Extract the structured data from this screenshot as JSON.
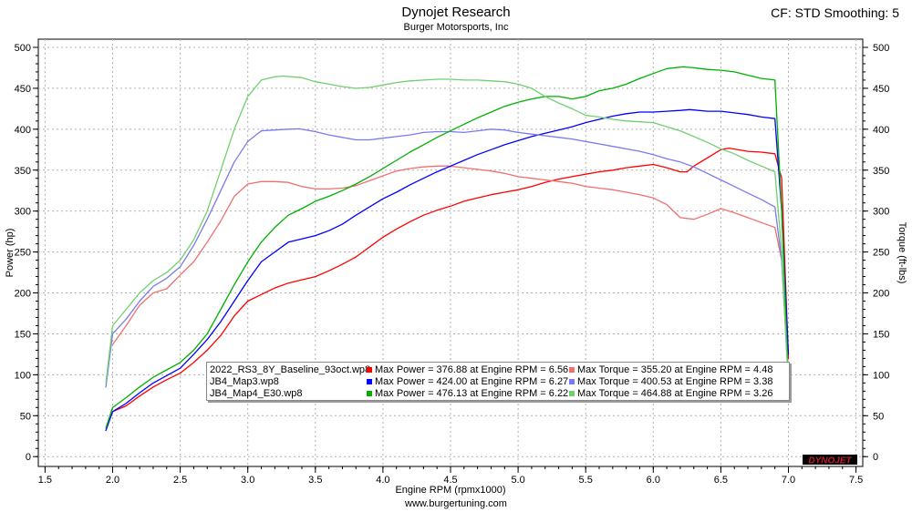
{
  "header": {
    "title": "Dynojet Research",
    "subtitle": "Burger Motorsports, Inc",
    "settings": "CF: STD Smoothing: 5"
  },
  "footer": {
    "url": "www.burgertuning.com"
  },
  "logo": {
    "text": "DYNOJET",
    "color": "#c0202a"
  },
  "legend": {
    "rows": [
      {
        "file": "2022_RS3_8Y_Baseline_93oct.wp8",
        "color": "#ff0000",
        "max_power": "Max Power = 376.88 at Engine RPM = 6.56",
        "max_torque": "Max Torque = 355.20 at Engine RPM = 4.48"
      },
      {
        "file": "JB4_Map3.wp8",
        "color": "#0000ff",
        "max_power": "Max Power = 424.00 at Engine RPM = 6.27",
        "max_torque": "Max Torque = 400.53 at Engine RPM = 3.38"
      },
      {
        "file": "JB4_Map4_E30.wp8",
        "color": "#00b000",
        "max_power": "Max Power = 476.13 at Engine RPM = 6.22",
        "max_torque": "Max Torque = 464.88 at Engine RPM = 3.26"
      }
    ]
  },
  "chart_data": {
    "type": "line",
    "title": "Dynojet Research",
    "subtitle": "Burger Motorsports, Inc",
    "xlabel": "Engine RPM (rpmx1000)",
    "ylabel": "Power (hp)",
    "y2label": "Torque (ft-lbs)",
    "xlim": [
      1.45,
      7.55
    ],
    "ylim": [
      -12,
      510
    ],
    "xticks": [
      "1.5",
      "2.0",
      "2.5",
      "3.0",
      "3.5",
      "4.0",
      "4.5",
      "5.0",
      "5.5",
      "6.0",
      "6.5",
      "7.0",
      "7.5"
    ],
    "yticks": [
      "0",
      "50",
      "100",
      "150",
      "200",
      "250",
      "300",
      "350",
      "400",
      "450",
      "500"
    ],
    "grid": true,
    "legend_position": "bottom-right",
    "series": [
      {
        "name": "2022_RS3_8Y_Baseline_93oct.wp8",
        "measure": "power",
        "color": "#ff0000",
        "x": [
          2.0,
          2.1,
          2.2,
          2.3,
          2.4,
          2.5,
          2.6,
          2.7,
          2.8,
          2.9,
          3.0,
          3.1,
          3.2,
          3.3,
          3.4,
          3.5,
          3.6,
          3.7,
          3.8,
          3.9,
          4.0,
          4.1,
          4.2,
          4.3,
          4.4,
          4.5,
          4.6,
          4.7,
          4.8,
          4.9,
          5.0,
          5.1,
          5.2,
          5.3,
          5.4,
          5.5,
          5.6,
          5.7,
          5.8,
          5.9,
          6.0,
          6.1,
          6.2,
          6.25,
          6.3,
          6.4,
          6.5,
          6.56,
          6.7,
          6.8,
          6.9,
          6.95,
          7.0
        ],
        "values": [
          55,
          62,
          74,
          85,
          94,
          102,
          115,
          130,
          148,
          172,
          190,
          198,
          206,
          212,
          216,
          220,
          227,
          235,
          244,
          256,
          268,
          278,
          287,
          295,
          301,
          306,
          312,
          316,
          320,
          323,
          326,
          330,
          335,
          339,
          342,
          345,
          348,
          350,
          353,
          355,
          357,
          353,
          348,
          348,
          355,
          365,
          375,
          376.88,
          373,
          372,
          370,
          340,
          120
        ]
      },
      {
        "name": "2022_RS3_8Y_Baseline_93oct.wp8",
        "measure": "torque",
        "color": "#f07070",
        "x": [
          2.0,
          2.1,
          2.2,
          2.3,
          2.4,
          2.5,
          2.6,
          2.7,
          2.8,
          2.9,
          3.0,
          3.1,
          3.2,
          3.3,
          3.4,
          3.5,
          3.6,
          3.7,
          3.8,
          3.9,
          4.0,
          4.1,
          4.2,
          4.3,
          4.4,
          4.48,
          4.6,
          4.7,
          4.8,
          4.9,
          5.0,
          5.1,
          5.2,
          5.3,
          5.4,
          5.5,
          5.6,
          5.7,
          5.8,
          5.9,
          6.0,
          6.1,
          6.2,
          6.3,
          6.4,
          6.5,
          6.6,
          6.7,
          6.8,
          6.9,
          6.95,
          7.0
        ],
        "values": [
          137,
          160,
          185,
          200,
          205,
          222,
          238,
          262,
          288,
          318,
          333,
          336,
          336,
          335,
          330,
          327,
          327,
          328,
          331,
          337,
          343,
          349,
          352,
          354,
          355,
          355.2,
          353,
          351,
          349,
          346,
          342,
          340,
          338,
          336,
          334,
          330,
          328,
          326,
          323,
          320,
          316,
          308,
          292,
          290,
          296,
          303,
          298,
          292,
          286,
          280,
          240,
          90
        ]
      },
      {
        "name": "JB4_Map3.wp8",
        "measure": "power",
        "color": "#0000ff",
        "x": [
          1.95,
          2.0,
          2.1,
          2.2,
          2.3,
          2.4,
          2.5,
          2.6,
          2.7,
          2.8,
          2.9,
          3.0,
          3.1,
          3.2,
          3.3,
          3.4,
          3.5,
          3.6,
          3.7,
          3.8,
          3.9,
          4.0,
          4.1,
          4.2,
          4.3,
          4.4,
          4.5,
          4.6,
          4.7,
          4.8,
          4.9,
          5.0,
          5.1,
          5.2,
          5.3,
          5.4,
          5.5,
          5.6,
          5.7,
          5.8,
          5.9,
          6.0,
          6.1,
          6.2,
          6.27,
          6.4,
          6.5,
          6.6,
          6.7,
          6.8,
          6.9,
          6.95,
          7.0
        ],
        "values": [
          32,
          55,
          65,
          78,
          90,
          99,
          108,
          125,
          143,
          165,
          190,
          215,
          238,
          250,
          262,
          266,
          270,
          276,
          284,
          295,
          305,
          315,
          323,
          332,
          340,
          348,
          355,
          362,
          369,
          375,
          381,
          386,
          391,
          395,
          399,
          403,
          408,
          412,
          416,
          419,
          421,
          421,
          422,
          423,
          424,
          422,
          422,
          420,
          418,
          415,
          413,
          300,
          125
        ]
      },
      {
        "name": "JB4_Map3.wp8",
        "measure": "torque",
        "color": "#7a7af0",
        "x": [
          1.95,
          2.0,
          2.1,
          2.2,
          2.3,
          2.4,
          2.5,
          2.6,
          2.7,
          2.8,
          2.9,
          3.0,
          3.1,
          3.2,
          3.3,
          3.38,
          3.5,
          3.6,
          3.7,
          3.8,
          3.9,
          4.0,
          4.1,
          4.2,
          4.3,
          4.4,
          4.5,
          4.6,
          4.7,
          4.8,
          4.9,
          5.0,
          5.1,
          5.2,
          5.3,
          5.4,
          5.5,
          5.6,
          5.7,
          5.8,
          5.9,
          6.0,
          6.1,
          6.2,
          6.3,
          6.4,
          6.5,
          6.6,
          6.7,
          6.8,
          6.9,
          6.95,
          7.0
        ],
        "values": [
          85,
          150,
          168,
          190,
          208,
          218,
          232,
          258,
          290,
          325,
          360,
          385,
          398,
          399,
          400,
          400.53,
          397,
          393,
          390,
          387,
          387,
          389,
          391,
          393,
          396,
          397,
          397,
          396,
          398,
          400,
          399,
          396,
          394,
          392,
          390,
          388,
          385,
          382,
          379,
          376,
          373,
          369,
          364,
          360,
          354,
          346,
          338,
          330,
          322,
          314,
          305,
          240,
          100
        ]
      },
      {
        "name": "JB4_Map4_E30.wp8",
        "measure": "power",
        "color": "#00b000",
        "x": [
          1.95,
          2.0,
          2.1,
          2.2,
          2.3,
          2.4,
          2.5,
          2.6,
          2.7,
          2.8,
          2.9,
          3.0,
          3.1,
          3.2,
          3.3,
          3.4,
          3.5,
          3.6,
          3.7,
          3.8,
          3.9,
          4.0,
          4.1,
          4.2,
          4.3,
          4.4,
          4.5,
          4.6,
          4.7,
          4.8,
          4.9,
          5.0,
          5.1,
          5.2,
          5.3,
          5.4,
          5.5,
          5.6,
          5.7,
          5.8,
          5.9,
          6.0,
          6.1,
          6.22,
          6.3,
          6.4,
          6.5,
          6.6,
          6.7,
          6.8,
          6.9,
          6.95,
          7.0
        ],
        "values": [
          35,
          60,
          72,
          85,
          97,
          106,
          115,
          130,
          150,
          180,
          210,
          238,
          262,
          280,
          295,
          303,
          312,
          318,
          325,
          333,
          342,
          352,
          362,
          372,
          381,
          390,
          398,
          406,
          414,
          421,
          428,
          433,
          437,
          440,
          440,
          437,
          440,
          447,
          450,
          455,
          462,
          468,
          474,
          476.13,
          475,
          473,
          472,
          470,
          466,
          462,
          460,
          300,
          90
        ]
      },
      {
        "name": "JB4_Map4_E30.wp8",
        "measure": "torque",
        "color": "#70d070",
        "x": [
          1.95,
          2.0,
          2.1,
          2.2,
          2.3,
          2.4,
          2.5,
          2.6,
          2.7,
          2.8,
          2.9,
          3.0,
          3.1,
          3.2,
          3.26,
          3.4,
          3.5,
          3.6,
          3.7,
          3.8,
          3.9,
          4.0,
          4.1,
          4.2,
          4.3,
          4.4,
          4.5,
          4.6,
          4.7,
          4.8,
          4.9,
          5.0,
          5.1,
          5.2,
          5.3,
          5.4,
          5.5,
          5.6,
          5.7,
          5.8,
          5.9,
          6.0,
          6.1,
          6.2,
          6.3,
          6.4,
          6.5,
          6.6,
          6.7,
          6.8,
          6.9,
          6.95,
          7.0
        ],
        "values": [
          90,
          160,
          180,
          200,
          215,
          225,
          240,
          265,
          300,
          350,
          400,
          440,
          460,
          464,
          464.88,
          463,
          458,
          455,
          452,
          450,
          451,
          454,
          457,
          459,
          460,
          461,
          461,
          460,
          460,
          459,
          458,
          455,
          450,
          440,
          432,
          425,
          417,
          415,
          412,
          410,
          409,
          408,
          403,
          398,
          391,
          384,
          376,
          370,
          362,
          355,
          348,
          250,
          85
        ]
      }
    ]
  }
}
